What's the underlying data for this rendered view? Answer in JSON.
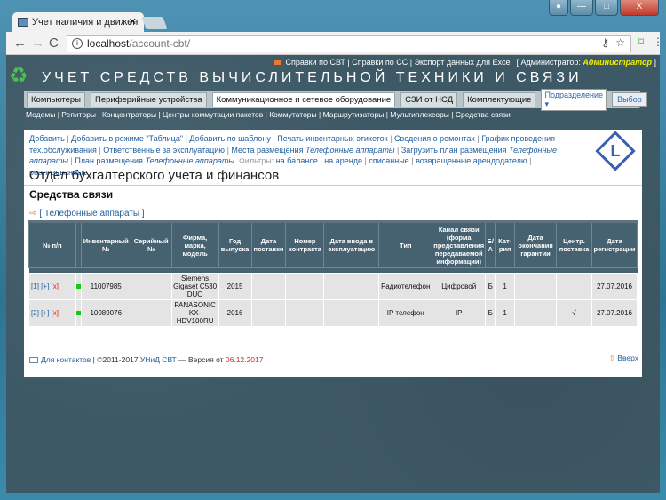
{
  "browser": {
    "tab_title": "Учет наличия и движен",
    "url_host": "localhost",
    "url_path": "/account-cbt/"
  },
  "top_links": {
    "items": [
      "Справки по СВТ",
      "Справки по СС",
      "Экспорт данных для Excel"
    ],
    "admin_label": "[ Администратор:",
    "admin_name": "Администратор",
    "admin_close": "]"
  },
  "app_title": "УЧЕТ СРЕДСТВ ВЫЧИСЛИТЕЛЬНОЙ ТЕХНИКИ И СВЯЗИ",
  "menu": {
    "items": [
      "Компьютеры",
      "Периферийные устройства",
      "Коммуникационное и сетевое оборудование",
      "СЗИ от НСД",
      "Комплектующие"
    ],
    "active": 2,
    "select_value": "Подразделение",
    "select_button": "Выбор"
  },
  "submenu": [
    "Модемы",
    "Репиторы",
    "Концентраторы",
    "Центры коммутации пакетов",
    "Коммутаторы",
    "Маршрутизаторы",
    "Мультиплексоры",
    "Средства связи"
  ],
  "actions": {
    "add": "Добавить",
    "add_table": "Добавить в режиме \"Таблица\"",
    "add_template": "Добавить по шаблону",
    "print_labels": "Печать инвентарных этикеток",
    "repairs": "Сведения о ремонтах",
    "maintenance": "График проведения тех.обслуживания",
    "responsible": "Ответственные за эксплуатацию",
    "places": "Места размещения",
    "places_it": "Телефонные аппараты",
    "upload_plan": "Загрузить план размещения",
    "upload_plan_it": "Телефонные аппараты",
    "plan": "План размещения",
    "plan_it": "Телефонные аппараты",
    "filters_label": "Фильтры:",
    "filters": [
      "на балансе",
      "на аренде",
      "списанные",
      "возвращенные арендодателю",
      "реализованные"
    ]
  },
  "department": "Отдел бухгалтерского учета и финансов",
  "section": "Средства связи",
  "group": "[ Телефонные аппараты ]",
  "table": {
    "headers": [
      "№ п/п",
      "",
      "Инвентарный №",
      "Серийный №",
      "Фирма, марка, модель",
      "Год выпуска",
      "Дата поставки",
      "Номер контракта",
      "Дата ввода в эксплуатацию",
      "Тип",
      "Канал связи (форма представления передаваемой информации)",
      "Б/А",
      "Кат-рия",
      "Дата окончания гарантии",
      "Центр. поставка",
      "Дата регистрации"
    ],
    "rows": [
      {
        "num": "1",
        "plus": "+",
        "del": "x",
        "inv": "11007985",
        "serial": "",
        "model": "Siemens Gigaset C530 DUO",
        "year": "2015",
        "delivery": "",
        "contract": "",
        "commission": "",
        "type": "Радиотелефон",
        "channel": "Цифровой",
        "ba": "Б",
        "cat": "1",
        "warranty": "",
        "central": "",
        "reg": "27.07.2016"
      },
      {
        "num": "2",
        "plus": "+",
        "del": "x",
        "inv": "10089076",
        "serial": "",
        "model": "PANASONIC KX-HDV100RU",
        "year": "2016",
        "delivery": "",
        "contract": "",
        "commission": "",
        "type": "IP телефон",
        "channel": "IP",
        "ba": "Б",
        "cat": "1",
        "warranty": "",
        "central": "√",
        "reg": "27.07.2016"
      }
    ]
  },
  "footer": {
    "contacts": "Для контактов",
    "copyright": "| ©2011-2017",
    "org": "УНиД СВТ",
    "version_label": "— Версия от",
    "version": "06.12.2017",
    "up": "Вверх"
  },
  "colors": {
    "header_bg": "#466270",
    "link": "#1f5e9e",
    "admin": "#f0f000",
    "status_dot": "#11cc11"
  }
}
